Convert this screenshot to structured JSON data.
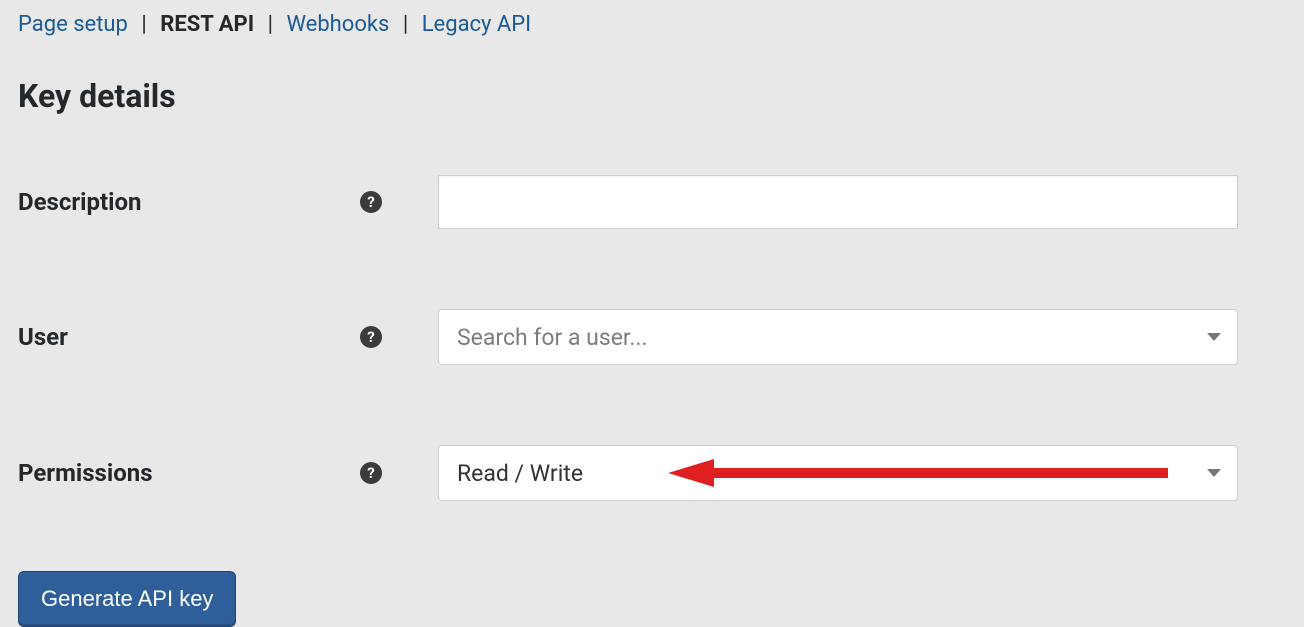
{
  "tabs": {
    "page_setup": "Page setup",
    "rest_api": "REST API",
    "webhooks": "Webhooks",
    "legacy_api": "Legacy API"
  },
  "section_title": "Key details",
  "fields": {
    "description": {
      "label": "Description",
      "value": ""
    },
    "user": {
      "label": "User",
      "placeholder": "Search for a user..."
    },
    "permissions": {
      "label": "Permissions",
      "value": "Read / Write"
    }
  },
  "button": {
    "generate_api_key": "Generate API key"
  },
  "help_icon_glyph": "?"
}
